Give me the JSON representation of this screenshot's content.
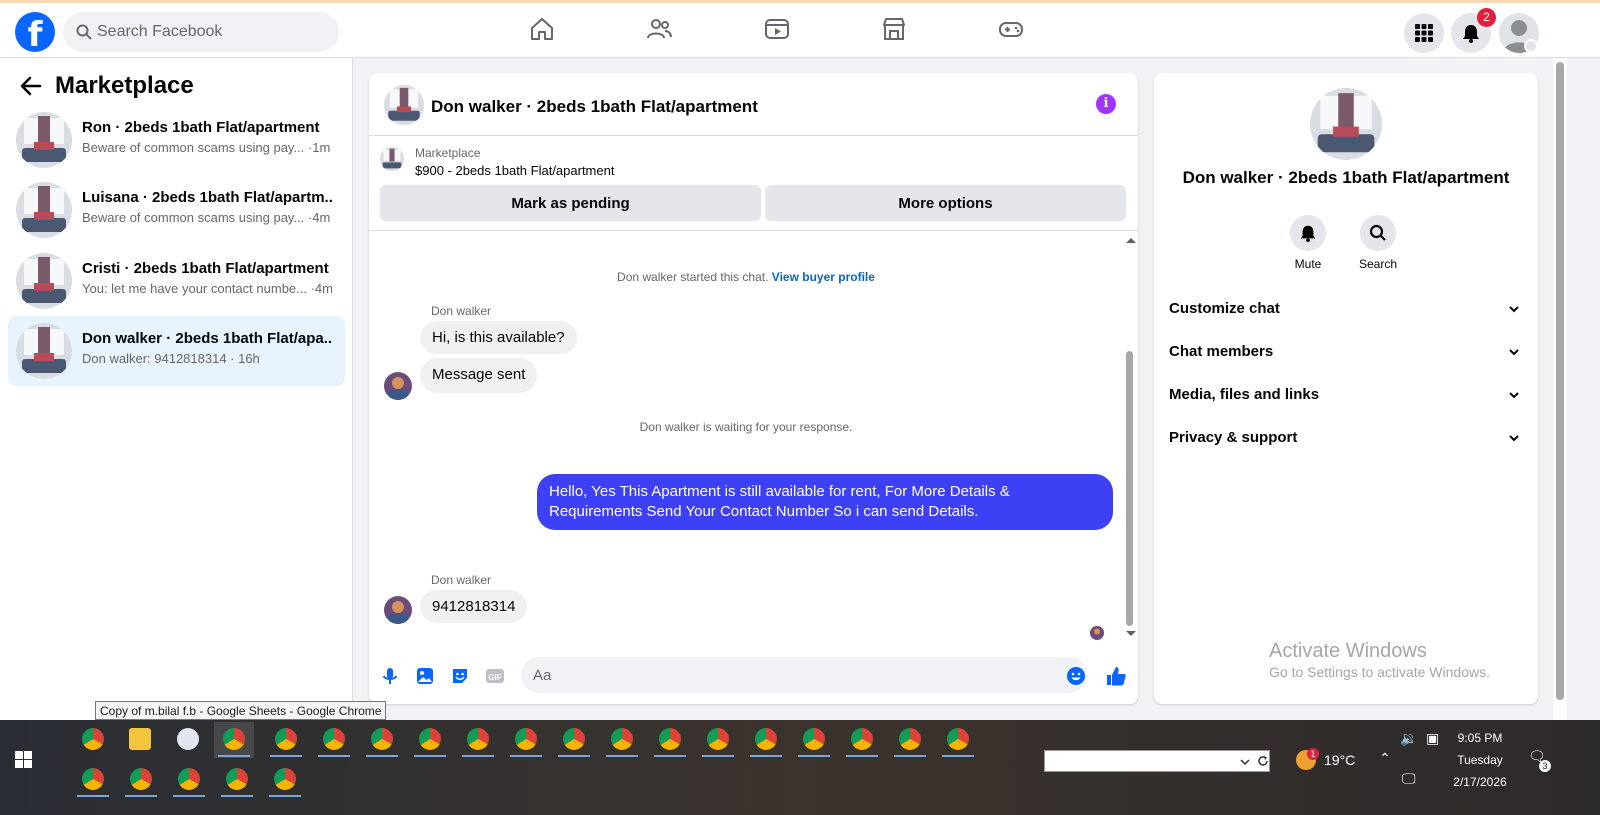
{
  "topbar": {
    "search_placeholder": "Search Facebook",
    "notification_count": "2"
  },
  "sidebar": {
    "title": "Marketplace",
    "conversations": [
      {
        "name": "Ron · 2beds 1bath Flat/apartment",
        "snippet": "Beware of common scams using pay... ·1m"
      },
      {
        "name": "Luisana · 2beds 1bath Flat/apartm...",
        "snippet": "Beware of common scams using pay... ·4m"
      },
      {
        "name": "Cristi · 2beds 1bath Flat/apartment",
        "snippet": "You: let me have your contact numbe... ·4m"
      },
      {
        "name": "Don walker · 2beds 1bath Flat/apa...",
        "snippet": "Don walker: 9412818314 · 16h"
      }
    ]
  },
  "chat": {
    "title": "Don walker · 2beds 1bath Flat/apartment",
    "listing_source": "Marketplace",
    "listing_price": "$900 - 2beds 1bath Flat/apartment",
    "mark_pending_label": "Mark as pending",
    "more_options_label": "More options",
    "started_text": "Don walker started this chat.",
    "view_profile_label": "View buyer profile",
    "sender_name_1": "Don walker",
    "msg_1": "Hi, is this available?",
    "msg_2": "Message sent",
    "waiting_text": "Don walker is waiting for your response.",
    "msg_out": "Hello, Yes This Apartment is still available for rent, For More Details & Requirements Send Your Contact Number So i can send Details.",
    "sender_name_2": "Don walker",
    "msg_3": "9412818314",
    "composer_placeholder": "Aa"
  },
  "info_panel": {
    "name": "Don walker · 2beds 1bath Flat/apartment",
    "mute_label": "Mute",
    "search_label": "Search",
    "sections": [
      "Customize chat",
      "Chat members",
      "Media, files and links",
      "Privacy & support"
    ]
  },
  "watermark": {
    "line1": "Activate Windows",
    "line2": "Go to Settings to activate Windows."
  },
  "tooltip": "Copy of m.bilal f.b - Google Sheets - Google Chrome",
  "taskbar": {
    "temperature": "19°C",
    "time": "9:05 PM",
    "day": "Tuesday",
    "date": "2/17/2026",
    "weather_badge": "1",
    "action_center_badge": "3"
  },
  "colors": {
    "brand": "#0866ff",
    "outgoing_bubble": "#3d40f5",
    "info_accent": "#a033ff",
    "active_conversation": "#e7f3ff"
  }
}
